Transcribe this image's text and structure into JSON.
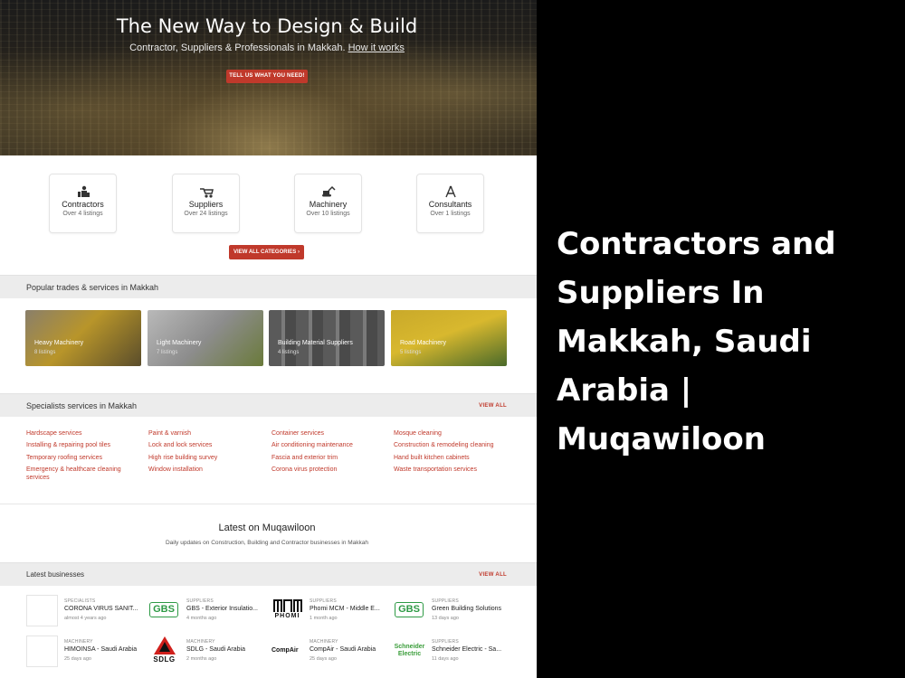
{
  "hero": {
    "title": "The New Way to Design & Build",
    "subtitle": "Contractor, Suppliers & Professionals in Makkah.",
    "how_link": "How it works",
    "cta": "TELL US WHAT YOU NEED!"
  },
  "categories": [
    {
      "name": "Contractors",
      "count": "Over 4 listings",
      "icon": "contractor-icon"
    },
    {
      "name": "Suppliers",
      "count": "Over 24 listings",
      "icon": "wheelbarrow-icon"
    },
    {
      "name": "Machinery",
      "count": "Over 10 listings",
      "icon": "excavator-icon"
    },
    {
      "name": "Consultants",
      "count": "Over 1 listings",
      "icon": "compass-icon"
    }
  ],
  "view_all_categories": "VIEW ALL CATEGORIES ›",
  "popular": {
    "title": "Popular trades & services in Makkah",
    "items": [
      {
        "name": "Heavy Machinery",
        "count": "8 listings"
      },
      {
        "name": "Light Machinery",
        "count": "7 listings"
      },
      {
        "name": "Building Material Suppliers",
        "count": "4 listings"
      },
      {
        "name": "Road Machinery",
        "count": "5 listings"
      }
    ]
  },
  "specialists": {
    "title": "Specialists services in Makkah",
    "view_all": "VIEW ALL",
    "columns": [
      [
        "Hardscape services",
        "Installing & repairing pool tiles",
        "Temporary roofing services",
        "Emergency & healthcare cleaning services"
      ],
      [
        "Paint & varnish",
        "Lock and lock services",
        "High rise building survey",
        "Window installation"
      ],
      [
        "Container services",
        "Air conditioning maintenance",
        "Fascia and exterior trim",
        "Corona virus protection"
      ],
      [
        "Mosque cleaning",
        "Construction & remodeling cleaning",
        "Hand built kitchen cabinets",
        "Waste transportation services"
      ]
    ]
  },
  "latest": {
    "title": "Latest on Muqawiloon",
    "subtitle": "Daily updates on Construction, Building and Contractor businesses in Makkah"
  },
  "latest_businesses": {
    "title": "Latest businesses",
    "view_all": "VIEW ALL",
    "items": [
      {
        "category": "SPECIALISTS",
        "name": "CORONA VIRUS SANIT...",
        "ago": "almost 4 years ago",
        "logo": ""
      },
      {
        "category": "SUPPLIERS",
        "name": "GBS - Exterior Insulatio...",
        "ago": "4 months ago",
        "logo": "GBS"
      },
      {
        "category": "SUPPLIERS",
        "name": "Phomi MCM - Middle E...",
        "ago": "1 month ago",
        "logo": "PHOMI"
      },
      {
        "category": "SUPPLIERS",
        "name": "Green Building Solutions",
        "ago": "13 days ago",
        "logo": "GBS"
      },
      {
        "category": "MACHINERY",
        "name": "HIMOINSA - Saudi Arabia",
        "ago": "25 days ago",
        "logo": ""
      },
      {
        "category": "MACHINERY",
        "name": "SDLG - Saudi Arabia",
        "ago": "2 months ago",
        "logo": "SDLG"
      },
      {
        "category": "MACHINERY",
        "name": "CompAir - Saudi Arabia",
        "ago": "25 days ago",
        "logo": "CompAir"
      },
      {
        "category": "SUPPLIERS",
        "name": "Schneider Electric - Sa...",
        "ago": "11 days ago",
        "logo": "Schneider Electric"
      }
    ]
  },
  "side_title": "Contractors and Suppliers In Makkah, Saudi Arabia | Muqawiloon",
  "colors": {
    "accent": "#c0392b",
    "band": "#ececec",
    "gbs_green": "#2e9a45"
  }
}
